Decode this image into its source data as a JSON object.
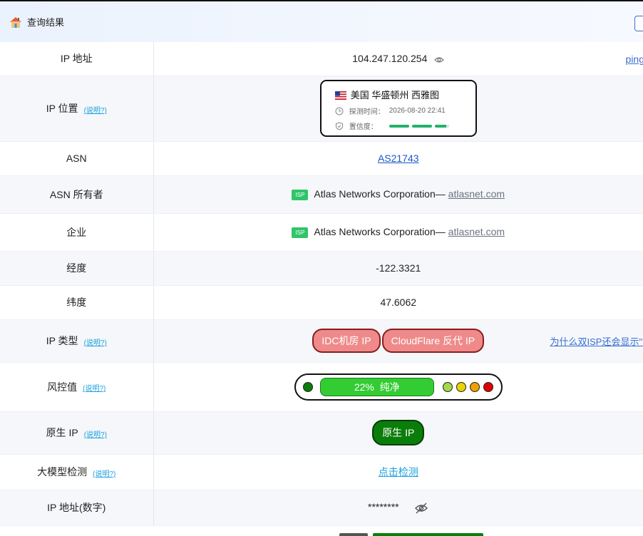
{
  "header": {
    "title": "查询结果"
  },
  "rows": {
    "ip": {
      "label": "IP 地址",
      "value": "104.247.120.254",
      "ping": "ping"
    },
    "location": {
      "label": "IP 位置",
      "hint": "(说明?)",
      "place": "美国 华盛顿州 西雅图",
      "detect_label": "探测时间：",
      "detect_time": "2026-08-20 22:41",
      "confidence_label": "置信度："
    },
    "asn": {
      "label": "ASN",
      "value": "AS21743"
    },
    "asn_owner": {
      "label": "ASN 所有者",
      "badge": "ISP",
      "name": "Atlas Networks Corporation—",
      "domain": "atlasnet.com"
    },
    "company": {
      "label": "企业",
      "badge": "ISP",
      "name": "Atlas Networks Corporation—",
      "domain": "atlasnet.com"
    },
    "longitude": {
      "label": "经度",
      "value": "-122.3321"
    },
    "latitude": {
      "label": "纬度",
      "value": "47.6062"
    },
    "ip_type": {
      "label": "IP 类型",
      "hint": "(说明?)",
      "tags": [
        "IDC机房 IP",
        "CloudFlare 反代 IP"
      ],
      "why": "为什么双ISP还会显示\"IDC"
    },
    "risk": {
      "label": "风控值",
      "hint": "(说明?)",
      "percent": "22%",
      "text": "纯净"
    },
    "native": {
      "label": "原生 IP",
      "hint": "(说明?)",
      "value": "原生 IP"
    },
    "llm": {
      "label": "大模型检测",
      "hint": "(说明?)",
      "action": "点击检测"
    },
    "ip_numeric": {
      "label": "IP 地址(数字)",
      "value": "********"
    }
  },
  "colors": {
    "green": "#33cc33",
    "dark_green": "#0a7d0a",
    "tag_red": "#ef8a8a",
    "link_blue": "#1a56c8"
  },
  "icons": [
    "home-icon",
    "eye-icon",
    "us-flag-icon",
    "clock-icon",
    "shield-icon",
    "eye-off-icon"
  ]
}
